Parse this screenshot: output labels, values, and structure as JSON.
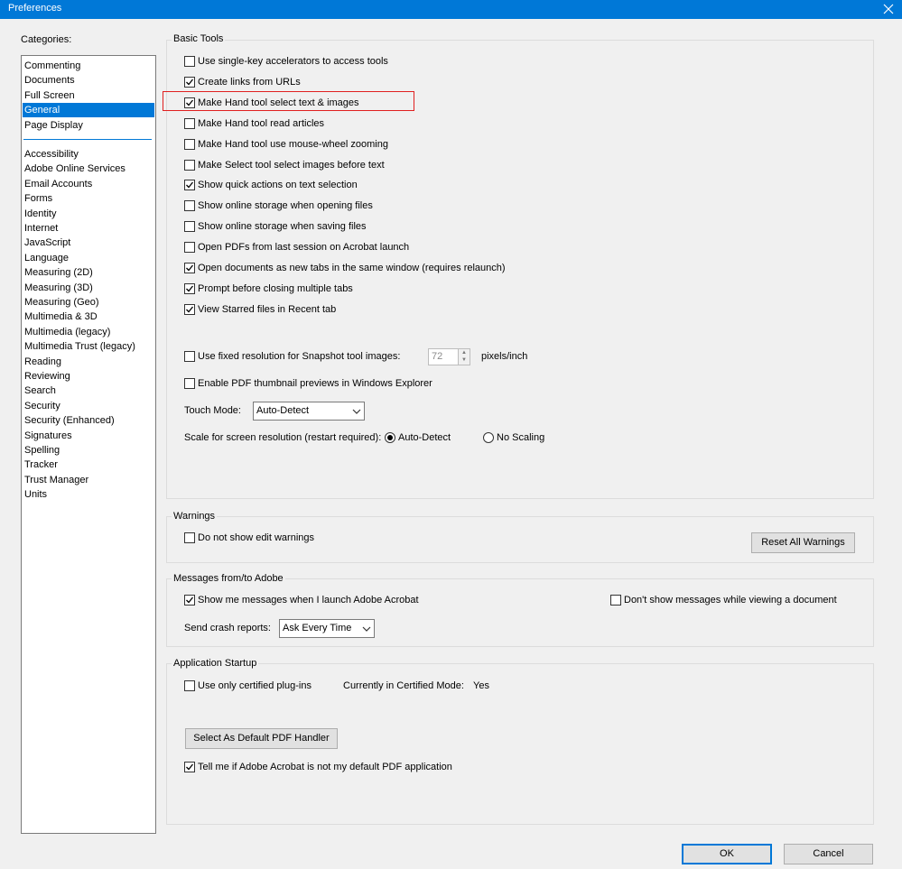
{
  "window": {
    "title": "Preferences"
  },
  "categories": {
    "label": "Categories:",
    "group1": [
      "Commenting",
      "Documents",
      "Full Screen",
      "General",
      "Page Display"
    ],
    "group2": [
      "Accessibility",
      "Adobe Online Services",
      "Email Accounts",
      "Forms",
      "Identity",
      "Internet",
      "JavaScript",
      "Language",
      "Measuring (2D)",
      "Measuring (3D)",
      "Measuring (Geo)",
      "Multimedia & 3D",
      "Multimedia (legacy)",
      "Multimedia Trust (legacy)",
      "Reading",
      "Reviewing",
      "Search",
      "Security",
      "Security (Enhanced)",
      "Signatures",
      "Spelling",
      "Tracker",
      "Trust Manager",
      "Units"
    ],
    "selected": "General"
  },
  "basic_tools": {
    "title": "Basic Tools",
    "options": [
      {
        "label": "Use single-key accelerators to access tools",
        "checked": false
      },
      {
        "label": "Create links from URLs",
        "checked": true
      },
      {
        "label": "Make Hand tool select text & images",
        "checked": true
      },
      {
        "label": "Make Hand tool read articles",
        "checked": false
      },
      {
        "label": "Make Hand tool use mouse-wheel zooming",
        "checked": false
      },
      {
        "label": "Make Select tool select images before text",
        "checked": false
      },
      {
        "label": "Show quick actions on text selection",
        "checked": true
      },
      {
        "label": "Show online storage when opening files",
        "checked": false
      },
      {
        "label": "Show online storage when saving files",
        "checked": false
      },
      {
        "label": "Open PDFs from last session on Acrobat launch",
        "checked": false
      },
      {
        "label": "Open documents as new tabs in the same window (requires relaunch)",
        "checked": true
      },
      {
        "label": "Prompt before closing multiple tabs",
        "checked": true
      },
      {
        "label": "View Starred files in Recent tab",
        "checked": true
      }
    ],
    "snapshot": {
      "label": "Use fixed resolution for Snapshot tool images:",
      "checked": false,
      "value": "72",
      "unit": "pixels/inch"
    },
    "thumbnail": {
      "label": "Enable PDF thumbnail previews in Windows Explorer",
      "checked": false
    },
    "touch_mode": {
      "label": "Touch Mode:",
      "value": "Auto-Detect"
    },
    "scale": {
      "label": "Scale for screen resolution (restart required):",
      "option1": "Auto-Detect",
      "option2": "No Scaling",
      "selected": "Auto-Detect"
    }
  },
  "warnings": {
    "title": "Warnings",
    "edit_warnings": {
      "label": "Do not show edit warnings",
      "checked": false
    },
    "reset_button": "Reset All Warnings"
  },
  "messages": {
    "title": "Messages from/to Adobe",
    "show_launch": {
      "label": "Show me messages when I launch Adobe Acrobat",
      "checked": true
    },
    "dont_show_viewing": {
      "label": "Don't show messages while viewing a document",
      "checked": false
    },
    "crash_label": "Send crash reports:",
    "crash_value": "Ask Every Time"
  },
  "startup": {
    "title": "Application Startup",
    "certified": {
      "label": "Use only certified plug-ins",
      "checked": false
    },
    "mode_label": "Currently in Certified Mode:",
    "mode_value": "Yes",
    "default_handler_button": "Select As Default PDF Handler",
    "tell_me": {
      "label": "Tell me if Adobe Acrobat is not my default PDF application",
      "checked": true
    }
  },
  "footer": {
    "ok": "OK",
    "cancel": "Cancel"
  }
}
